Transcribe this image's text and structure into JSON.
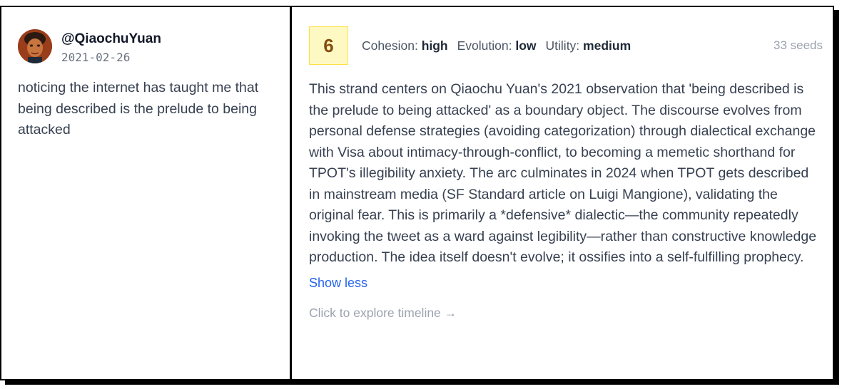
{
  "tweet": {
    "handle": "@QiaochuYuan",
    "date": "2021-02-26",
    "text": "noticing the internet has taught me that being described is the prelude to being attacked",
    "avatar_icon": "profile-photo"
  },
  "strand": {
    "score": "6",
    "metrics": [
      {
        "label": "Cohesion:",
        "value": "high"
      },
      {
        "label": "Evolution:",
        "value": "low"
      },
      {
        "label": "Utility:",
        "value": "medium"
      }
    ],
    "seeds": "33 seeds",
    "summary": "This strand centers on Qiaochu Yuan's 2021 observation that 'being described is the prelude to being attacked' as a boundary object. The discourse evolves from personal defense strategies (avoiding categorization) through dialectical exchange with Visa about intimacy-through-conflict, to becoming a memetic shorthand for TPOT's illegibility anxiety. The arc culminates in 2024 when TPOT gets described in mainstream media (SF Standard article on Luigi Mangione), validating the original fear. This is primarily a *defensive* dialectic—the community repeatedly invoking the tweet as a ward against legibility—rather than constructive knowledge production. The idea itself doesn't evolve; it ossifies into a self-fulfilling prophecy.",
    "show_less": "Show less",
    "explore": "Click to explore timeline →"
  },
  "colors": {
    "badge_bg": "#fef9c3",
    "badge_text": "#854d0e",
    "link": "#2563eb",
    "muted": "#9ca3af"
  }
}
